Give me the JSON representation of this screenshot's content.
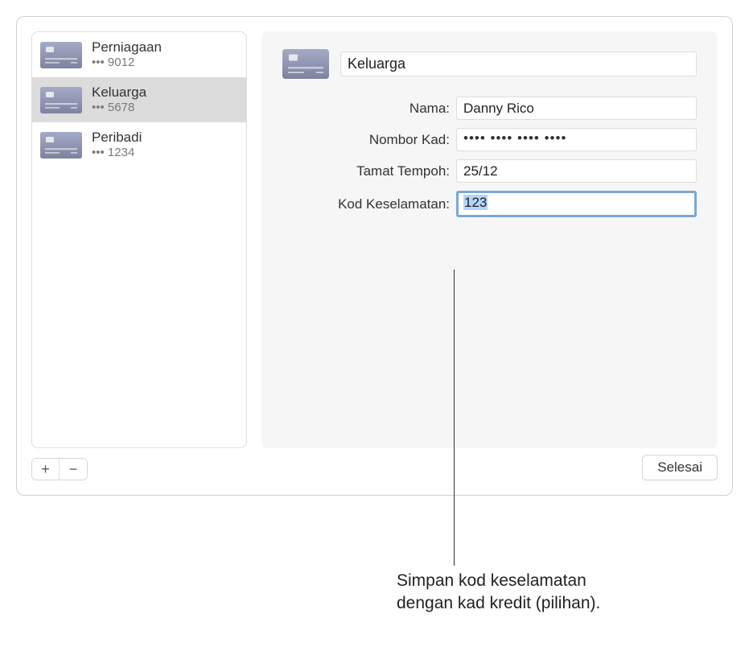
{
  "sidebar": {
    "cards": [
      {
        "title": "Perniagaan",
        "sub": "••• 9012"
      },
      {
        "title": "Keluarga",
        "sub": "••• 5678"
      },
      {
        "title": "Peribadi",
        "sub": "••• 1234"
      }
    ]
  },
  "detail": {
    "title_value": "Keluarga",
    "rows": {
      "name": {
        "label": "Nama:",
        "value": "Danny Rico"
      },
      "card_number": {
        "label": "Nombor Kad:",
        "value": "•••• •••• •••• ••••"
      },
      "expiry": {
        "label": "Tamat Tempoh:",
        "value": "25/12"
      },
      "security": {
        "label": "Kod Keselamatan:",
        "value": "123"
      }
    }
  },
  "buttons": {
    "done": "Selesai",
    "add": "+",
    "remove": "−"
  },
  "callout": {
    "line1": "Simpan kod keselamatan",
    "line2": "dengan kad kredit (pilihan)."
  }
}
